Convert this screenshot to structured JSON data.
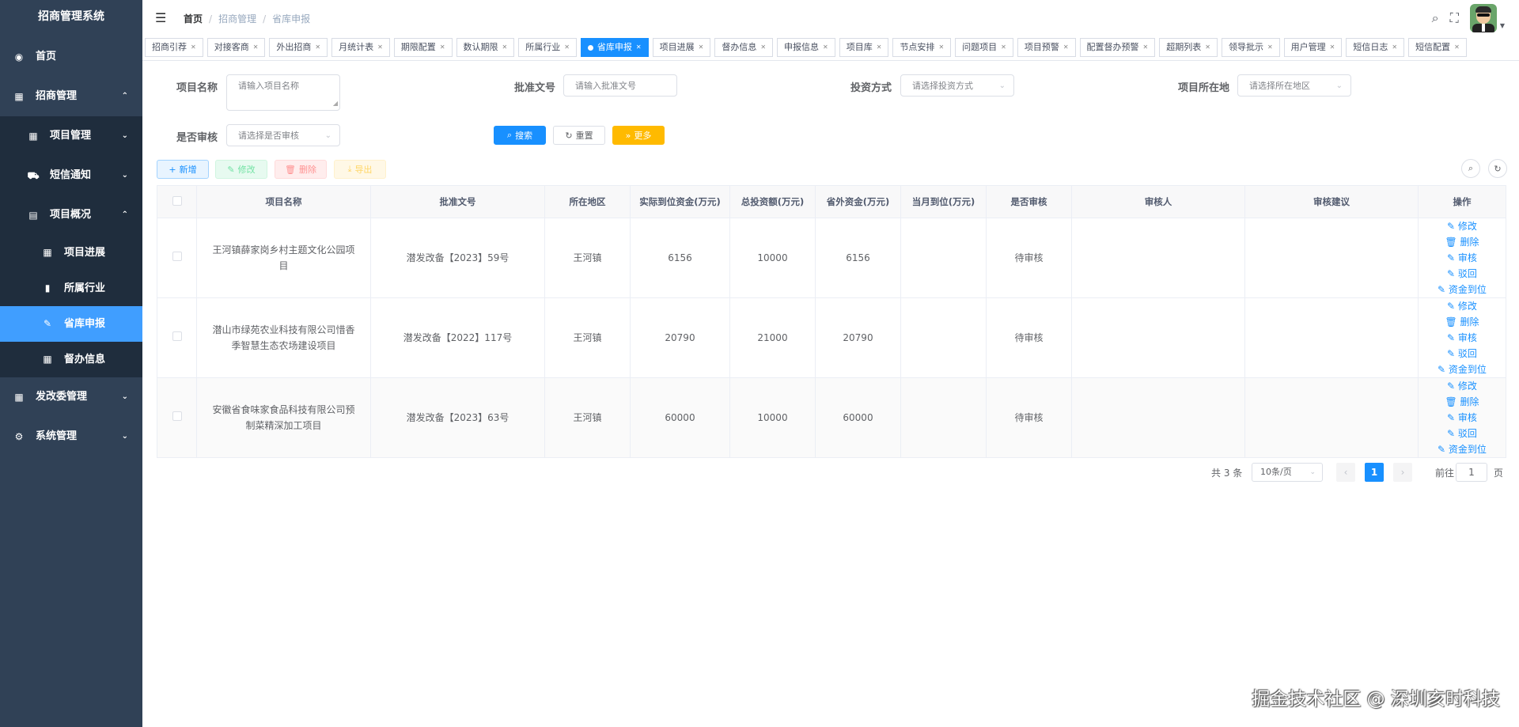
{
  "sidebar": {
    "title": "招商管理系统",
    "items": [
      {
        "label": "首页",
        "icon": "dashboard-icon",
        "glyph": "◉",
        "arrow": ""
      },
      {
        "label": "招商管理",
        "icon": "grid-icon",
        "glyph": "▦",
        "arrow": "⌃"
      },
      {
        "label": "项目管理",
        "icon": "table-icon",
        "glyph": "▦",
        "arrow": "⌄"
      },
      {
        "label": "短信通知",
        "icon": "bus-icon",
        "glyph": "⛟",
        "arrow": "⌄"
      },
      {
        "label": "项目概况",
        "icon": "document-icon",
        "glyph": "▤",
        "arrow": "⌃"
      },
      {
        "label": "项目进展",
        "icon": "table-icon",
        "glyph": "▦",
        "arrow": ""
      },
      {
        "label": "所属行业",
        "icon": "bar-chart-icon",
        "glyph": "▮",
        "arrow": ""
      },
      {
        "label": "省库申报",
        "icon": "edit-icon",
        "glyph": "✎",
        "arrow": ""
      },
      {
        "label": "督办信息",
        "icon": "table-icon",
        "glyph": "▦",
        "arrow": ""
      },
      {
        "label": "发改委管理",
        "icon": "grid-icon",
        "glyph": "▦",
        "arrow": "⌄"
      },
      {
        "label": "系统管理",
        "icon": "gear-icon",
        "glyph": "⚙",
        "arrow": "⌄"
      }
    ]
  },
  "breadcrumb": [
    "首页",
    "招商管理",
    "省库申报"
  ],
  "tags": [
    {
      "label": "招商引荐"
    },
    {
      "label": "对接客商"
    },
    {
      "label": "外出招商"
    },
    {
      "label": "月统计表"
    },
    {
      "label": "期限配置"
    },
    {
      "label": "数认期限"
    },
    {
      "label": "所属行业"
    },
    {
      "label": "省库申报",
      "active": true
    },
    {
      "label": "项目进展"
    },
    {
      "label": "督办信息"
    },
    {
      "label": "申报信息"
    },
    {
      "label": "项目库"
    },
    {
      "label": "节点安排"
    },
    {
      "label": "问题项目"
    },
    {
      "label": "项目预警"
    },
    {
      "label": "配置督办预警"
    },
    {
      "label": "超期列表"
    },
    {
      "label": "领导批示"
    },
    {
      "label": "用户管理"
    },
    {
      "label": "短信日志"
    },
    {
      "label": "短信配置"
    }
  ],
  "search": {
    "project_name_label": "项目名称",
    "project_name_placeholder": "请输入项目名称",
    "approval_no_label": "批准文号",
    "approval_no_placeholder": "请输入批准文号",
    "invest_method_label": "投资方式",
    "invest_method_placeholder": "请选择投资方式",
    "location_label": "项目所在地",
    "location_placeholder": "请选择所在地区",
    "audited_label": "是否审核",
    "audited_placeholder": "请选择是否审核",
    "search_btn": "搜索",
    "reset_btn": "重置",
    "more_btn": "更多"
  },
  "toolbar": {
    "add": "新增",
    "edit": "修改",
    "delete": "删除",
    "export": "导出"
  },
  "table": {
    "columns": [
      "项目名称",
      "批准文号",
      "所在地区",
      "实际到位资金(万元)",
      "总投资额(万元)",
      "省外资金(万元)",
      "当月到位(万元)",
      "是否审核",
      "审核人",
      "审核建议",
      "操作"
    ],
    "ops": {
      "edit": "修改",
      "delete": "删除",
      "audit": "审核",
      "reject": "驳回",
      "funds": "资金到位"
    },
    "rows": [
      {
        "name": "王河镇薛家岗乡村主题文化公园项目",
        "approval": "潜发改备【2023】59号",
        "region": "王河镇",
        "actual": "6156",
        "total": "10000",
        "outside": "6156",
        "month": "",
        "status": "待审核",
        "auditor": "",
        "advice": ""
      },
      {
        "name": "潜山市绿苑农业科技有限公司惜香季智慧生态农场建设项目",
        "approval": "潜发改备【2022】117号",
        "region": "王河镇",
        "actual": "20790",
        "total": "21000",
        "outside": "20790",
        "month": "",
        "status": "待审核",
        "auditor": "",
        "advice": ""
      },
      {
        "name": "安徽省食味家食品科技有限公司预制菜精深加工项目",
        "approval": "潜发改备【2023】63号",
        "region": "王河镇",
        "actual": "60000",
        "total": "10000",
        "outside": "60000",
        "month": "",
        "status": "待审核",
        "auditor": "",
        "advice": ""
      }
    ]
  },
  "pagination": {
    "total": "共 3 条",
    "page_size": "10条/页",
    "current_page": "1",
    "goto_label": "前往",
    "goto_value": "1",
    "page_unit": "页"
  },
  "watermark": "掘金技术社区 @ 深圳亥时科技",
  "colors": {
    "sidebar_bg": "#304156",
    "active": "#1890ff",
    "status_pending": "#13ce66",
    "more_btn": "#ffba00"
  }
}
